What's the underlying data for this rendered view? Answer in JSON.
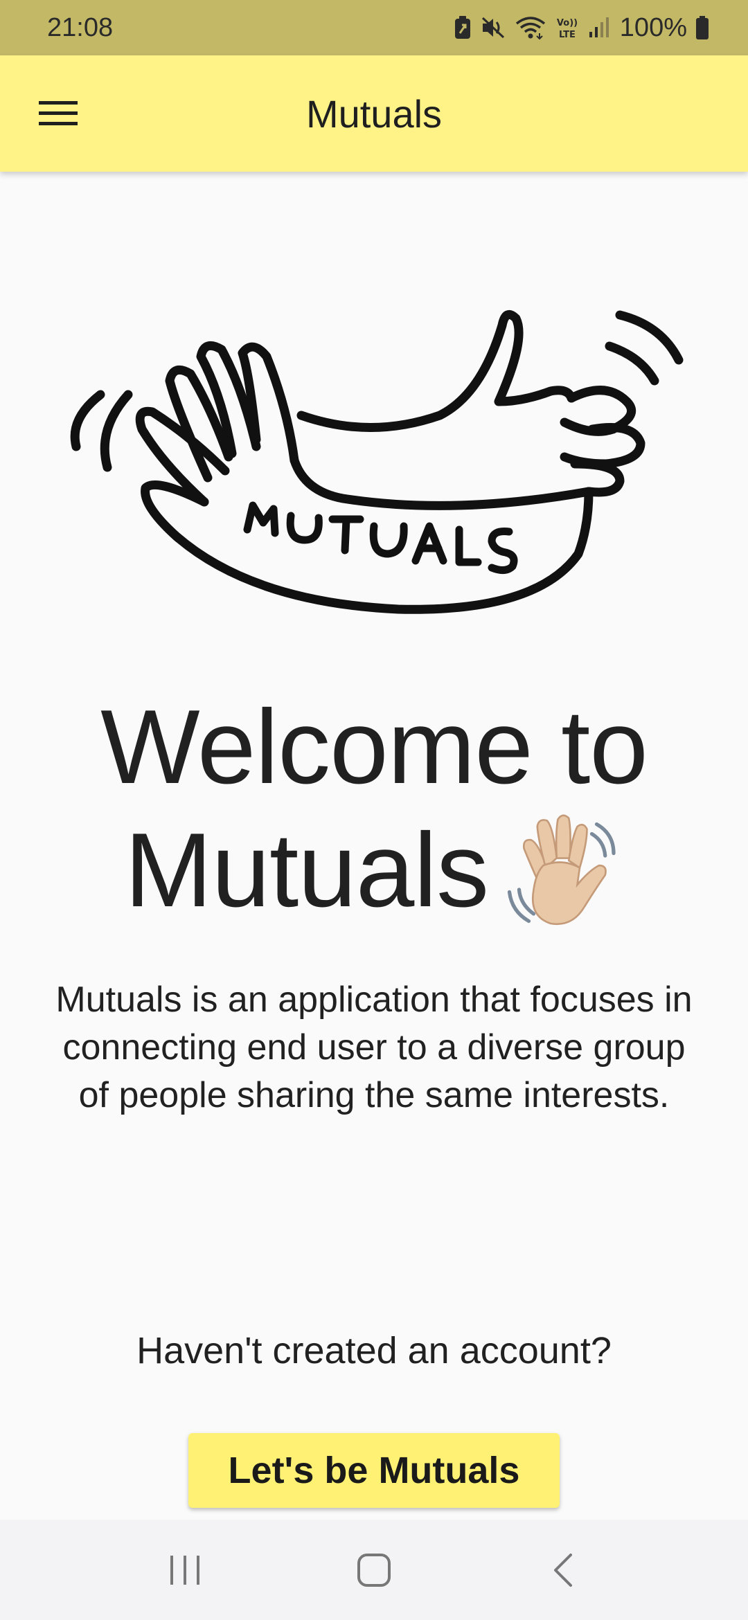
{
  "status_bar": {
    "time": "21:08",
    "battery_percent": "100%",
    "icons": [
      "battery-saver-icon",
      "mute-icon",
      "wifi-icon",
      "volte-icon",
      "signal-icon",
      "battery-icon"
    ]
  },
  "app_bar": {
    "title": "Mutuals",
    "menu_icon": "hamburger-menu-icon"
  },
  "logo": {
    "text": "MUTUALS"
  },
  "welcome": {
    "line1": "Welcome to",
    "line2": "Mutuals",
    "emoji": "waving-hand-icon"
  },
  "description": "Mutuals is an application that focuses in connecting end user to a diverse group of people sharing the same interests.",
  "account_prompt": "Haven't created an account?",
  "cta_button": {
    "label": "Let's be Mutuals",
    "color": "#fff173"
  },
  "colors": {
    "status_bar": "#c3b866",
    "app_bar": "#fff387",
    "background": "#fafafa"
  },
  "nav_bar": {
    "icons": [
      "recent-apps-icon",
      "home-icon",
      "back-icon"
    ]
  }
}
